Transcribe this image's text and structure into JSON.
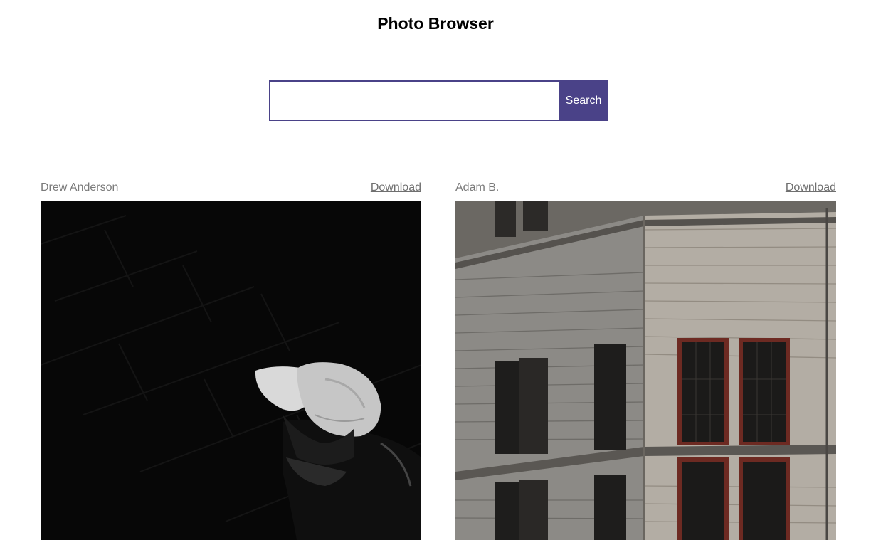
{
  "header": {
    "title": "Photo Browser"
  },
  "search": {
    "value": "",
    "placeholder": "",
    "button_label": "Search",
    "accent": "#4a4288"
  },
  "photos": [
    {
      "author": "Drew Anderson",
      "download_label": "Download",
      "subject": "person-in-white-cap"
    },
    {
      "author": "Adam B.",
      "download_label": "Download",
      "subject": "stone-building-corner"
    }
  ]
}
